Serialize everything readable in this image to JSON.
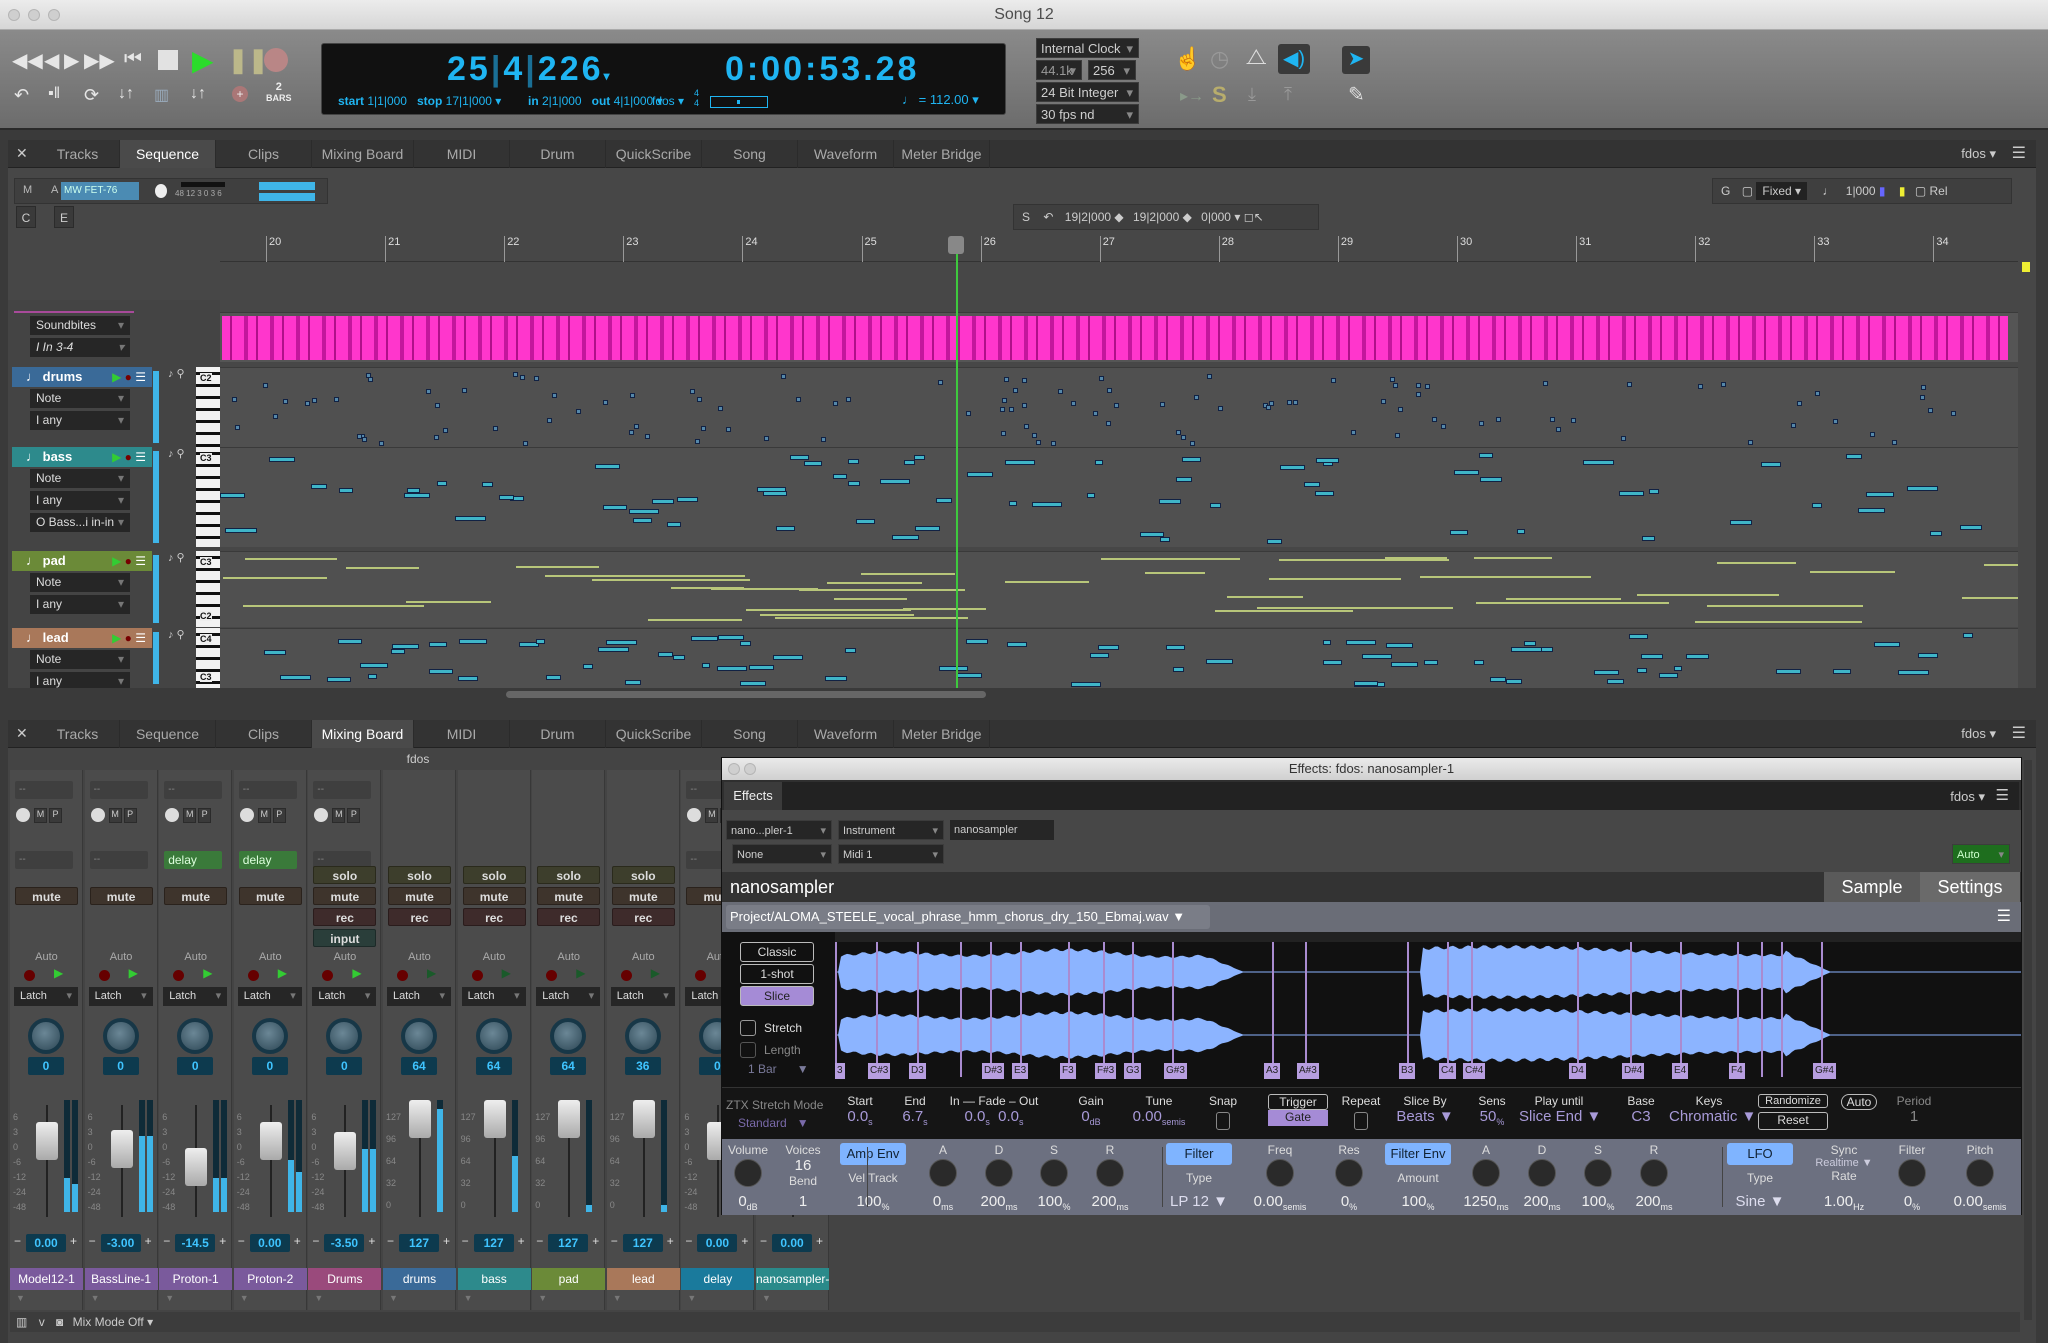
{
  "window": {
    "title": "Song 12"
  },
  "transport": {
    "bars_value": "2",
    "bars_unit": "BARS",
    "counter_bar": "25",
    "counter_beat": "4",
    "counter_tick": "226",
    "counter_time": "0:00:53.28",
    "start_label": "start",
    "start": "1|1|000",
    "stop_label": "stop",
    "stop": "17|1|000",
    "in_label": "in",
    "in": "2|1|000",
    "out_label": "out",
    "out": "4|1|000",
    "chunk": "fdos",
    "meter_num": "4",
    "meter_den": "4",
    "tempo": "112.00",
    "clock": "Internal Clock",
    "sample_rate": "44.1k",
    "buffer": "256",
    "bit_depth": "24 Bit Integer",
    "frame_rate": "30 fps nd"
  },
  "tabs": [
    "Tracks",
    "Sequence",
    "Clips",
    "Mixing Board",
    "MIDI",
    "Drum",
    "QuickScribe",
    "Song",
    "Waveform",
    "Meter Bridge"
  ],
  "upper": {
    "active_tab": "Sequence",
    "chunk": "fdos",
    "toolbar": {
      "m": "M",
      "a": "A",
      "plugin": "MW FET-76",
      "meter_ticks": "48 12 3 0 3 6",
      "c": "C",
      "e": "E",
      "s": "S",
      "sel_start": "19|2|000",
      "sel_end": "19|2|000",
      "sel_len": "0|000",
      "g": "G",
      "grid_mode": "Fixed",
      "grid_value": "1|000",
      "rel": "Rel"
    },
    "ruler": [
      "20",
      "21",
      "22",
      "23",
      "24",
      "25",
      "26",
      "27",
      "28",
      "29",
      "30",
      "31",
      "32",
      "33",
      "34"
    ],
    "tracks": [
      {
        "name": "Soundbites",
        "sub": "In 3-4"
      },
      {
        "name": "drums",
        "mode": "Note",
        "filter": "any",
        "key_labels": [
          "C2"
        ],
        "color": "#3a6a98"
      },
      {
        "name": "bass",
        "mode": "Note",
        "filter": "any",
        "extra": "Bass...i in-in",
        "key_labels": [
          "C3"
        ],
        "color": "#2d8a8c"
      },
      {
        "name": "pad",
        "mode": "Note",
        "filter": "any",
        "key_labels": [
          "C3",
          "C2"
        ],
        "color": "#6b8a38"
      },
      {
        "name": "lead",
        "mode": "Note",
        "filter": "any",
        "key_labels": [
          "C4",
          "C3"
        ],
        "color": "#a9785a"
      }
    ],
    "colors": {
      "soundbites": "#ff2fc8",
      "note": "#3fb5c8",
      "pad_note": "#b8c67a"
    }
  },
  "mixer": {
    "active_tab": "Mixing Board",
    "chunk": "fdos",
    "header": "fdos",
    "mix_mode": "Mix Mode Off",
    "strips": [
      {
        "name": "Model12-1",
        "color": "#7a5a9c",
        "send": "--",
        "solo": false,
        "pan": "0",
        "volume": "0.00",
        "scale": "audio",
        "fader": 0.72,
        "meter": [
          0.3,
          0.25
        ]
      },
      {
        "name": "BassLine-1",
        "color": "#7a5a9c",
        "send": "--",
        "solo": false,
        "pan": "0",
        "volume": "-3.00",
        "scale": "audio",
        "fader": 0.62,
        "meter": [
          0.68,
          0.68
        ]
      },
      {
        "name": "Proton-1",
        "color": "#7a5a9c",
        "send": "delay",
        "solo": false,
        "pan": "0",
        "volume": "-14.5",
        "scale": "audio",
        "fader": 0.4,
        "meter": [
          0.3,
          0.3
        ]
      },
      {
        "name": "Proton-2",
        "color": "#7a5a9c",
        "send": "delay",
        "solo": false,
        "pan": "0",
        "volume": "0.00",
        "scale": "audio",
        "fader": 0.72,
        "meter": [
          0.46,
          0.36
        ]
      },
      {
        "name": "Drums",
        "color": "#9a4a7c",
        "send": "--",
        "solo": true,
        "input": true,
        "pan": "0",
        "volume": "-3.50",
        "scale": "audio",
        "fader": 0.6,
        "meter": [
          0.56,
          0.56
        ]
      },
      {
        "name": "drums",
        "color": "#3a6a98",
        "solo": true,
        "pan": "64",
        "volume": "127",
        "scale": "midi",
        "fader": 1.0,
        "meter": [
          0.92
        ]
      },
      {
        "name": "bass",
        "color": "#2d8a8c",
        "solo": true,
        "pan": "64",
        "volume": "127",
        "scale": "midi",
        "fader": 1.0,
        "meter": [
          0.5
        ]
      },
      {
        "name": "pad",
        "color": "#6b8a38",
        "solo": true,
        "pan": "64",
        "volume": "127",
        "scale": "midi",
        "fader": 1.0,
        "meter": [
          0.06
        ]
      },
      {
        "name": "lead",
        "color": "#a9785a",
        "solo": true,
        "pan": "36",
        "volume": "127",
        "scale": "midi",
        "fader": 1.0,
        "meter": [
          0.06
        ]
      },
      {
        "name": "delay",
        "color": "#1a7a9c",
        "send": "--",
        "solo": false,
        "pan": "0",
        "volume": "0.00",
        "scale": "audio",
        "fader": 0.72,
        "meter": [
          0,
          0
        ]
      },
      {
        "name": "nanosampler-1",
        "color": "#2a8a8a",
        "send": "--",
        "solo": false,
        "pan": "0",
        "volume": "0.00",
        "scale": "audio",
        "fader": 0.72,
        "meter": [
          0,
          0
        ]
      }
    ],
    "labels": {
      "mute": "mute",
      "solo": "solo",
      "rec": "rec",
      "input": "input",
      "auto": "Auto",
      "latch": "Latch",
      "m": "M",
      "p": "P"
    },
    "scale_audio": [
      "6",
      "3",
      "0",
      "-6",
      "-12",
      "-24",
      "-48"
    ],
    "scale_midi": [
      "127",
      "96",
      "64",
      "32",
      "0"
    ]
  },
  "effects": {
    "title": "Effects: fdos: nanosampler-1",
    "tab": "Effects",
    "chunk": "fdos",
    "plugin": "nano...pler-1",
    "type": "Instrument",
    "instance": "nanosampler",
    "input": "None",
    "midi": "Midi 1",
    "automation": "Auto",
    "header": "nanosampler",
    "tab_sample": "Sample",
    "tab_settings": "Settings",
    "file": "Project/ALOMA_STEELE_vocal_phrase_hmm_chorus_dry_150_Ebmaj.wav",
    "modes": [
      "Classic",
      "1-shot",
      "Slice"
    ],
    "active_mode": "Slice",
    "stretch": "Stretch",
    "length": "Length",
    "length_value": "1 Bar",
    "stretch_mode_label": "ZTX Stretch Mode",
    "stretch_mode": "Standard",
    "slices": [
      "3",
      "C#3",
      "D3",
      "",
      "D#3",
      "E3",
      "F3",
      "F#3",
      "G3",
      "G#3",
      "A3",
      "A#3",
      "B3",
      "C4",
      "C#4",
      "D4",
      "D#4",
      "E4",
      "F4",
      "",
      "",
      "G#4"
    ],
    "waveform_color": "#8cb4ff",
    "params": [
      {
        "label": "Start",
        "value": "0.0",
        "unit": "s"
      },
      {
        "label": "End",
        "value": "6.7",
        "unit": "s"
      },
      {
        "label": "In — Fade – Out",
        "value": "0.0",
        "unit": "s",
        "value2": "0.0"
      },
      {
        "label": "Gain",
        "value": "0",
        "unit": "dB"
      },
      {
        "label": "Tune",
        "value": "0.00",
        "unit": "semis"
      },
      {
        "label": "Snap",
        "value": "",
        "unit": ""
      },
      {
        "label": "Trigger",
        "value": "Gate",
        "unit": ""
      },
      {
        "label": "Repeat",
        "value": "",
        "unit": ""
      },
      {
        "label": "Slice By",
        "value": "Beats ▼",
        "unit": ""
      },
      {
        "label": "Sens",
        "value": "50",
        "unit": "%"
      },
      {
        "label": "Play until",
        "value": "Slice End ▼",
        "unit": ""
      },
      {
        "label": "Base",
        "value": "C3",
        "unit": ""
      },
      {
        "label": "Keys",
        "value": "Chromatic ▼",
        "unit": ""
      },
      {
        "label": "Randomize",
        "value": "Reset",
        "unit": ""
      },
      {
        "label": "Auto",
        "value": "",
        "unit": ""
      },
      {
        "label": "Period",
        "value": "1",
        "unit": ""
      }
    ],
    "controls": [
      {
        "label": "Volume",
        "value": "0",
        "unit": "dB",
        "knob": true
      },
      {
        "label": "Voices",
        "top": "16",
        "sub": "Bend",
        "value": "1",
        "unit": ""
      },
      {
        "label": "Amp Env",
        "button": true,
        "sub": "Vel Track",
        "value": "100",
        "unit": "%"
      },
      {
        "label": "A",
        "value": "0",
        "unit": "ms",
        "knob": true
      },
      {
        "label": "D",
        "value": "200",
        "unit": "ms",
        "knob": true
      },
      {
        "label": "S",
        "value": "100",
        "unit": "%",
        "knob": true
      },
      {
        "label": "R",
        "value": "200",
        "unit": "ms",
        "knob": true
      },
      {
        "label": "Filter",
        "button": true,
        "sub": "Type",
        "value": "LP 12 ▼",
        "unit": ""
      },
      {
        "label": "Freq",
        "value": "0.00",
        "unit": "semis",
        "knob": true
      },
      {
        "label": "Res",
        "value": "0",
        "unit": "%",
        "knob": true
      },
      {
        "label": "Filter Env",
        "button": true,
        "sub": "Amount",
        "value": "100",
        "unit": "%"
      },
      {
        "label": "A",
        "value": "1250",
        "unit": "ms",
        "knob": true
      },
      {
        "label": "D",
        "value": "200",
        "unit": "ms",
        "knob": true
      },
      {
        "label": "S",
        "value": "100",
        "unit": "%",
        "knob": true
      },
      {
        "label": "R",
        "value": "200",
        "unit": "ms",
        "knob": true
      },
      {
        "label": "LFO",
        "button": true,
        "sub": "Type",
        "value": "Sine ▼",
        "unit": ""
      },
      {
        "label": "Sync",
        "top": "Realtime ▼",
        "sub": "Rate",
        "value": "1.00",
        "unit": "Hz"
      },
      {
        "label": "Filter",
        "value": "0",
        "unit": "%",
        "knob": true
      },
      {
        "label": "Pitch",
        "value": "0.00",
        "unit": "semis",
        "knob": true
      }
    ]
  }
}
